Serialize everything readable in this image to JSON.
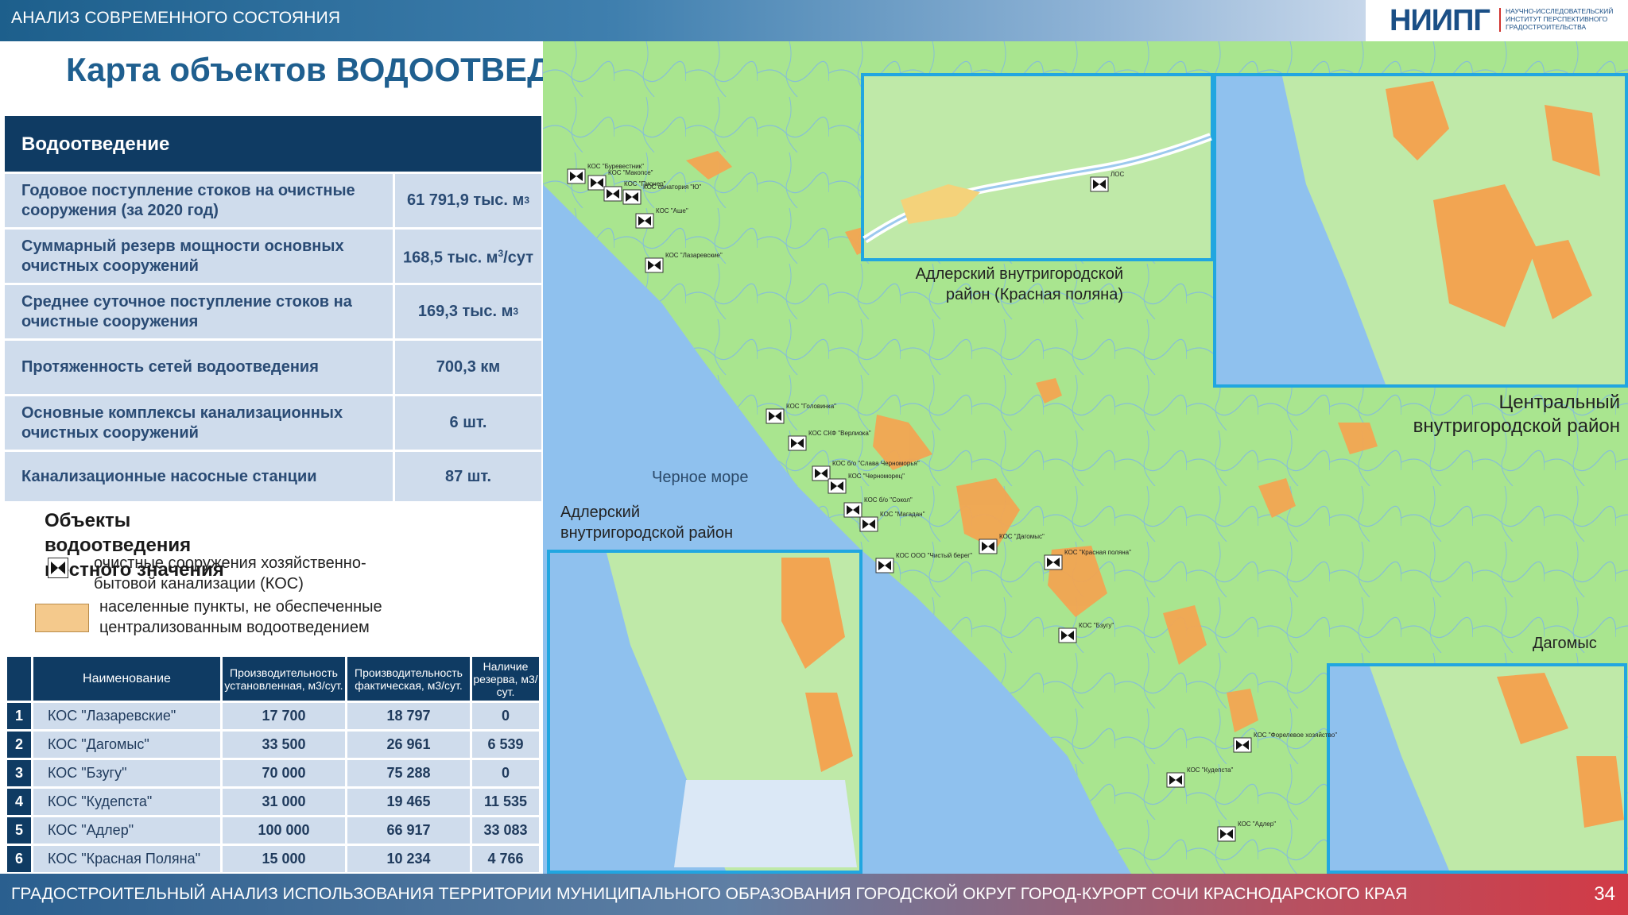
{
  "header": {
    "section": "АНАЛИЗ СОВРЕМЕННОГО СОСТОЯНИЯ",
    "logo": "НИИПГ",
    "logo_sub": "НАУЧНО-ИССЛЕДОВАТЕЛЬСКИЙ ИНСТИТУТ ПЕРСПЕКТИВНОГО ГРАДОСТРОИТЕЛЬСТВА"
  },
  "title": "Карта объектов ВОДООТВЕДЕНИЯ",
  "summary": {
    "heading": "Водоотведение",
    "rows": [
      {
        "label": "Годовое поступление стоков на очистные сооружения (за 2020 год)",
        "value": "61 791,9 тыс. м",
        "sup": "3"
      },
      {
        "label": "Суммарный резерв мощности основных очистных сооружений",
        "value": "168,5 тыс. м",
        "sup": "3",
        "value_tail": "/сут"
      },
      {
        "label": "Среднее суточное поступление стоков на очистные сооружения",
        "value": "169,3 тыс. м",
        "sup": "3"
      },
      {
        "label": "Протяженность сетей водоотведения",
        "value": "700,3 км"
      },
      {
        "label": "Основные комплексы канализационных очистных сооружений",
        "value": "6 шт."
      },
      {
        "label": "Канализационные насосные станции",
        "value": "87 шт."
      }
    ]
  },
  "legend": {
    "title": "Объекты водоотведения местного значения",
    "kos": "очистные сооружения хозяйственно-бытовой канализации (КОС)",
    "settlements": "населенные пункты, не обеспеченные централизованным водоотведением"
  },
  "kos_table": {
    "headers": [
      "Наименование",
      "Производительность установленная, м3/сут.",
      "Производительность фактическая, м3/сут.",
      "Наличие резерва, м3/сут."
    ],
    "rows": [
      {
        "n": "1",
        "name": "КОС \"Лазаревские\"",
        "installed": "17 700",
        "actual": "18 797",
        "reserve": "0"
      },
      {
        "n": "2",
        "name": "КОС \"Дагомыс\"",
        "installed": "33 500",
        "actual": "26 961",
        "reserve": "6 539"
      },
      {
        "n": "3",
        "name": "КОС \"Бзугу\"",
        "installed": "70 000",
        "actual": "75 288",
        "reserve": "0"
      },
      {
        "n": "4",
        "name": "КОС \"Кудепста\"",
        "installed": "31 000",
        "actual": "19 465",
        "reserve": "11 535"
      },
      {
        "n": "5",
        "name": "КОС \"Адлер\"",
        "installed": "100 000",
        "actual": "66 917",
        "reserve": "33 083"
      },
      {
        "n": "6",
        "name": "КОС \"Красная Поляна\"",
        "installed": "15 000",
        "actual": "10 234",
        "reserve": "4 766"
      }
    ]
  },
  "map": {
    "sea": "Черное море",
    "adler_krasnaya": "Адлерский внутригородской район (Красная поляна)",
    "central": "Центральный внутригородской район",
    "adler": "Адлерский внутригородской район",
    "dagomys": "Дагомыс",
    "markers": [
      "КОС \"Буревестник\"",
      "КОС \"Макопсе\"",
      "КОС \"Пионер\"",
      "КОС санатория \"Ю\"",
      "КОС \"Аше\"",
      "КОС \"Лазаревские\"",
      "КОС \"Головинка\"",
      "КОС СКФ \"Верлиока\"",
      "КОС б/о \"Слава Черноморья\"",
      "КОС \"Черноморец\"",
      "КОС б/о \"Сокол\"",
      "КОС \"Магадан\"",
      "КОС ООО \"Чистый берег\"",
      "КОС \"Дагомыс\"",
      "КОС \"Бзугу\"",
      "КОС \"Форелевое хозяйство\"",
      "КОС \"Кудепста\"",
      "КОС \"Адлер\"",
      "КОС \"Красная поляна\"",
      "ЛОС"
    ]
  },
  "footer": {
    "text": "ГРАДОСТРОИТЕЛЬНЫЙ АНАЛИЗ  ИСПОЛЬЗОВАНИЯ ТЕРРИТОРИИ МУНИЦИПАЛЬНОГО ОБРАЗОВАНИЯ ГОРОДСКОЙ ОКРУГ ГОРОД-КУРОРТ СОЧИ КРАСНОДАРСКОГО КРАЯ",
    "page": "34"
  }
}
